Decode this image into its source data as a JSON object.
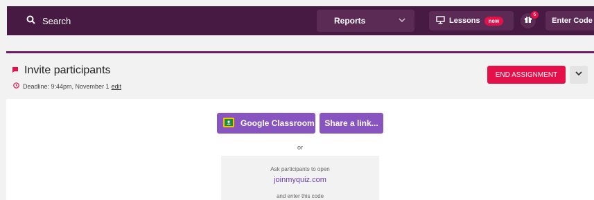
{
  "topbar": {
    "search_label": "Search",
    "reports_label": "Reports",
    "lessons_label": "Lessons",
    "lessons_badge": "new",
    "gift_count": "6",
    "enter_code_label": "Enter Code",
    "colors": {
      "bar": "#461a42",
      "button": "#5b2b56",
      "badge": "#e5104a"
    }
  },
  "card": {
    "title": "Invite participants",
    "deadline": "Deadline: 9:44pm, November 1",
    "edit_label": "edit",
    "end_label": "END ASSIGNMENT",
    "icons": {
      "title": "flag-icon",
      "deadline": "clock-icon",
      "expand": "chevron-down-icon"
    }
  },
  "invite": {
    "google_classroom_label": "Google Classroom",
    "share_label": "Share a link...",
    "or_label": "or",
    "ask_text": "Ask participants to open",
    "site": "joinmyquiz.com",
    "enter_text": "and enter this code",
    "accent": "#8854c0"
  }
}
